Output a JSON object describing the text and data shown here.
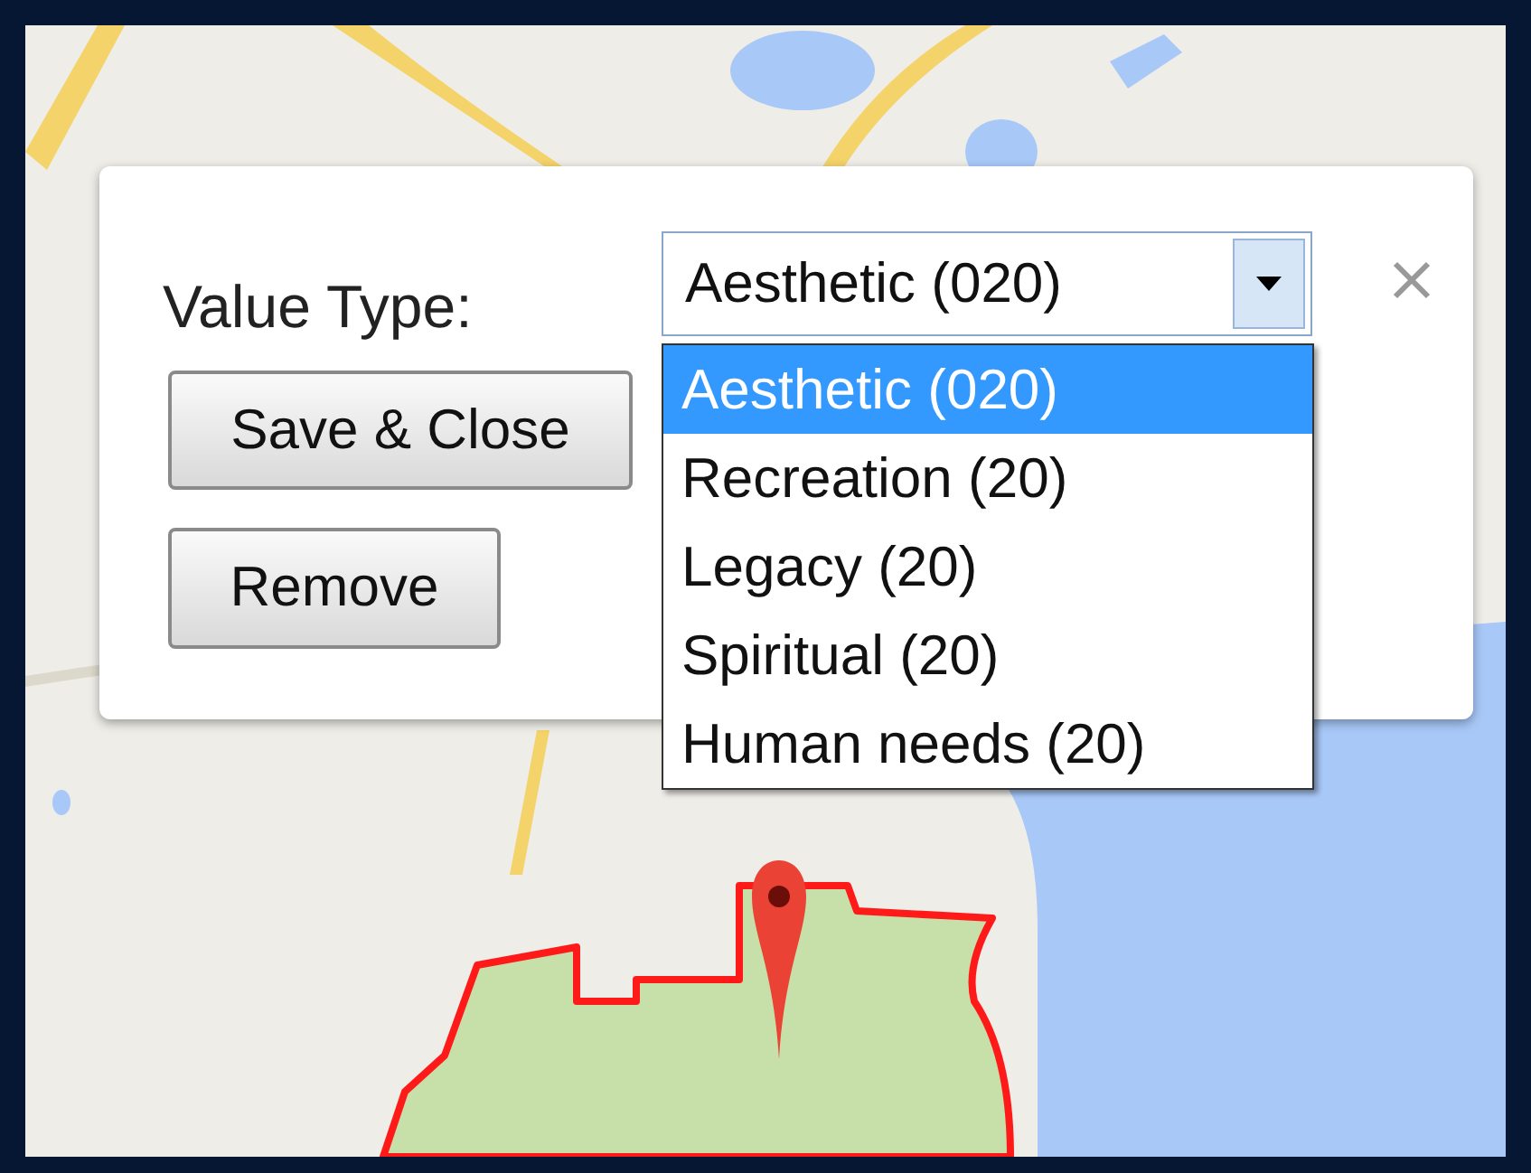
{
  "dialog": {
    "field_label": "Value Type:",
    "value": "Aesthetic (020)",
    "options": [
      {
        "label": "Aesthetic (020)",
        "selected": true
      },
      {
        "label": "Recreation (20)",
        "selected": false
      },
      {
        "label": "Legacy (20)",
        "selected": false
      },
      {
        "label": "Spiritual (20)",
        "selected": false
      },
      {
        "label": "Human needs (20)",
        "selected": false
      }
    ],
    "buttons": [
      "Save & Close",
      "Remove"
    ]
  }
}
